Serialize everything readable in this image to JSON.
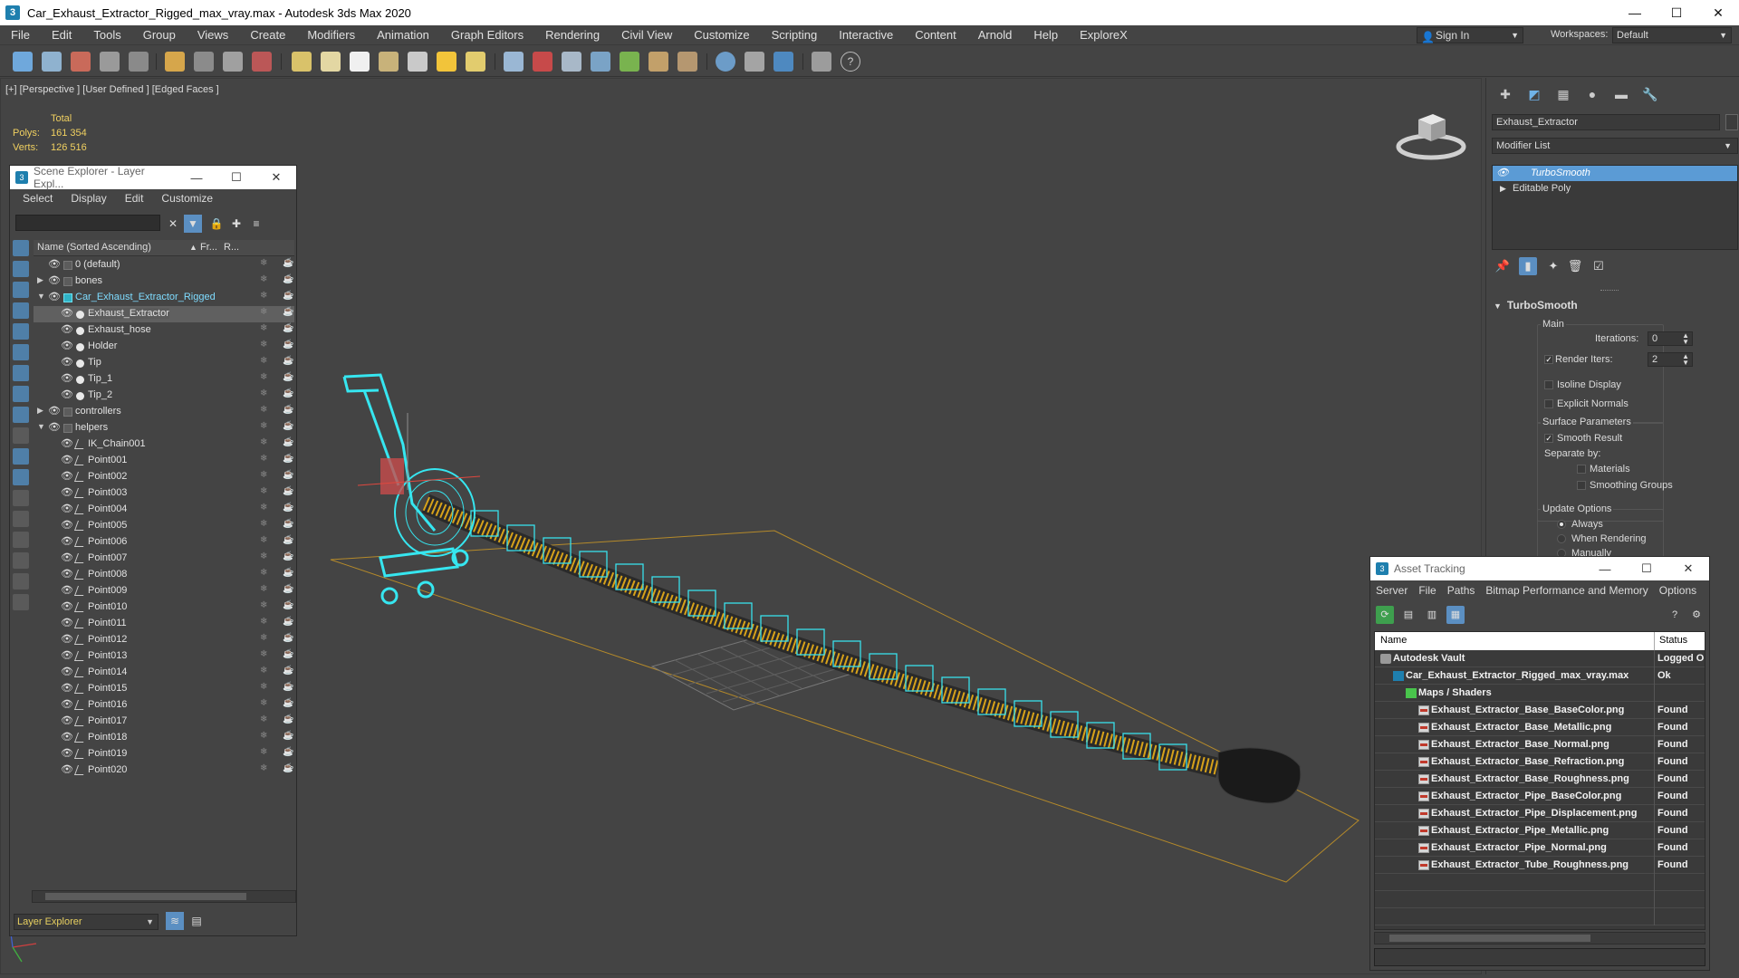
{
  "window": {
    "title": "Car_Exhaust_Extractor_Rigged_max_vray.max - Autodesk 3ds Max 2020",
    "controls": [
      "—",
      "☐",
      "✕"
    ]
  },
  "menu": [
    "File",
    "Edit",
    "Tools",
    "Group",
    "Views",
    "Create",
    "Modifiers",
    "Animation",
    "Graph Editors",
    "Rendering",
    "Civil View",
    "Customize",
    "Scripting",
    "Interactive",
    "Content",
    "Arnold",
    "Help",
    "ExploreX"
  ],
  "signin": {
    "label": "Sign In"
  },
  "workspace": {
    "label": "Workspaces:",
    "value": "Default"
  },
  "viewport": {
    "label": "[+] [Perspective ] [User Defined ] [Edged Faces ]",
    "stats": {
      "total": "Total",
      "polys_label": "Polys:",
      "polys": "161 354",
      "verts_label": "Verts:",
      "verts": "126 516"
    }
  },
  "scene_explorer": {
    "title": "Scene Explorer - Layer Expl...",
    "menu": [
      "Select",
      "Display",
      "Edit",
      "Customize"
    ],
    "columns": {
      "name": "Name (Sorted Ascending)",
      "frozen": "Fr...",
      "render": "R..."
    },
    "rows": [
      {
        "name": "0 (default)",
        "depth": 0,
        "type": "layer",
        "expand": ""
      },
      {
        "name": "bones",
        "depth": 0,
        "type": "layer",
        "expand": "▶"
      },
      {
        "name": "Car_Exhaust_Extractor_Rigged",
        "depth": 0,
        "type": "layer-active",
        "expand": "▼"
      },
      {
        "name": "Exhaust_Extractor",
        "depth": 1,
        "type": "object",
        "selected": true
      },
      {
        "name": "Exhaust_hose",
        "depth": 1,
        "type": "object"
      },
      {
        "name": "Holder",
        "depth": 1,
        "type": "object"
      },
      {
        "name": "Tip",
        "depth": 1,
        "type": "object"
      },
      {
        "name": "Tip_1",
        "depth": 1,
        "type": "object"
      },
      {
        "name": "Tip_2",
        "depth": 1,
        "type": "object"
      },
      {
        "name": "controllers",
        "depth": 0,
        "type": "layer",
        "expand": "▶"
      },
      {
        "name": "helpers",
        "depth": 0,
        "type": "layer",
        "expand": "▼"
      },
      {
        "name": "IK_Chain001",
        "depth": 1,
        "type": "helper"
      },
      {
        "name": "Point001",
        "depth": 1,
        "type": "helper"
      },
      {
        "name": "Point002",
        "depth": 1,
        "type": "helper"
      },
      {
        "name": "Point003",
        "depth": 1,
        "type": "helper"
      },
      {
        "name": "Point004",
        "depth": 1,
        "type": "helper"
      },
      {
        "name": "Point005",
        "depth": 1,
        "type": "helper"
      },
      {
        "name": "Point006",
        "depth": 1,
        "type": "helper"
      },
      {
        "name": "Point007",
        "depth": 1,
        "type": "helper"
      },
      {
        "name": "Point008",
        "depth": 1,
        "type": "helper"
      },
      {
        "name": "Point009",
        "depth": 1,
        "type": "helper"
      },
      {
        "name": "Point010",
        "depth": 1,
        "type": "helper"
      },
      {
        "name": "Point011",
        "depth": 1,
        "type": "helper"
      },
      {
        "name": "Point012",
        "depth": 1,
        "type": "helper"
      },
      {
        "name": "Point013",
        "depth": 1,
        "type": "helper"
      },
      {
        "name": "Point014",
        "depth": 1,
        "type": "helper"
      },
      {
        "name": "Point015",
        "depth": 1,
        "type": "helper"
      },
      {
        "name": "Point016",
        "depth": 1,
        "type": "helper"
      },
      {
        "name": "Point017",
        "depth": 1,
        "type": "helper"
      },
      {
        "name": "Point018",
        "depth": 1,
        "type": "helper"
      },
      {
        "name": "Point019",
        "depth": 1,
        "type": "helper"
      },
      {
        "name": "Point020",
        "depth": 1,
        "type": "helper"
      }
    ],
    "bottom_dropdown": "Layer Explorer"
  },
  "command_panel": {
    "object_name": "Exhaust_Extractor",
    "modifier_list": "Modifier List",
    "stack": [
      {
        "label": "TurboSmooth",
        "selected": true
      },
      {
        "label": "Editable Poly",
        "selected": false
      }
    ],
    "turbosmooth": {
      "title": "TurboSmooth",
      "main": "Main",
      "iterations_label": "Iterations:",
      "iterations": "0",
      "render_iters_label": "Render Iters:",
      "render_iters": "2",
      "isoline": "Isoline Display",
      "explicit_normals": "Explicit Normals",
      "surface_params": "Surface Parameters",
      "smooth_result": "Smooth Result",
      "separate_by": "Separate by:",
      "materials": "Materials",
      "smoothing_groups": "Smoothing Groups",
      "update_options": "Update Options",
      "always": "Always",
      "when_rendering": "When Rendering",
      "manually": "Manually"
    }
  },
  "asset_tracking": {
    "title": "Asset Tracking",
    "menu": [
      "Server",
      "File",
      "Paths",
      "Bitmap Performance and Memory",
      "Options"
    ],
    "columns": {
      "name": "Name",
      "status": "Status"
    },
    "rows": [
      {
        "name": "Autodesk Vault",
        "status": "Logged O",
        "depth": 0,
        "icon": "vault"
      },
      {
        "name": "Car_Exhaust_Extractor_Rigged_max_vray.max",
        "status": "Ok",
        "depth": 1,
        "icon": "max"
      },
      {
        "name": "Maps / Shaders",
        "status": "",
        "depth": 2,
        "icon": "maps"
      },
      {
        "name": "Exhaust_Extractor_Base_BaseColor.png",
        "status": "Found",
        "depth": 3,
        "icon": "png"
      },
      {
        "name": "Exhaust_Extractor_Base_Metallic.png",
        "status": "Found",
        "depth": 3,
        "icon": "png"
      },
      {
        "name": "Exhaust_Extractor_Base_Normal.png",
        "status": "Found",
        "depth": 3,
        "icon": "png"
      },
      {
        "name": "Exhaust_Extractor_Base_Refraction.png",
        "status": "Found",
        "depth": 3,
        "icon": "png"
      },
      {
        "name": "Exhaust_Extractor_Base_Roughness.png",
        "status": "Found",
        "depth": 3,
        "icon": "png"
      },
      {
        "name": "Exhaust_Extractor_Pipe_BaseColor.png",
        "status": "Found",
        "depth": 3,
        "icon": "png"
      },
      {
        "name": "Exhaust_Extractor_Pipe_Displacement.png",
        "status": "Found",
        "depth": 3,
        "icon": "png"
      },
      {
        "name": "Exhaust_Extractor_Pipe_Metallic.png",
        "status": "Found",
        "depth": 3,
        "icon": "png"
      },
      {
        "name": "Exhaust_Extractor_Pipe_Normal.png",
        "status": "Found",
        "depth": 3,
        "icon": "png"
      },
      {
        "name": "Exhaust_Extractor_Tube_Roughness.png",
        "status": "Found",
        "depth": 3,
        "icon": "png"
      }
    ]
  },
  "colors": {
    "selection": "#5b9bd5",
    "wire_cyan": "#2fe6f0",
    "stats_yellow": "#f0d060",
    "grid_orange": "#b58a2a"
  }
}
